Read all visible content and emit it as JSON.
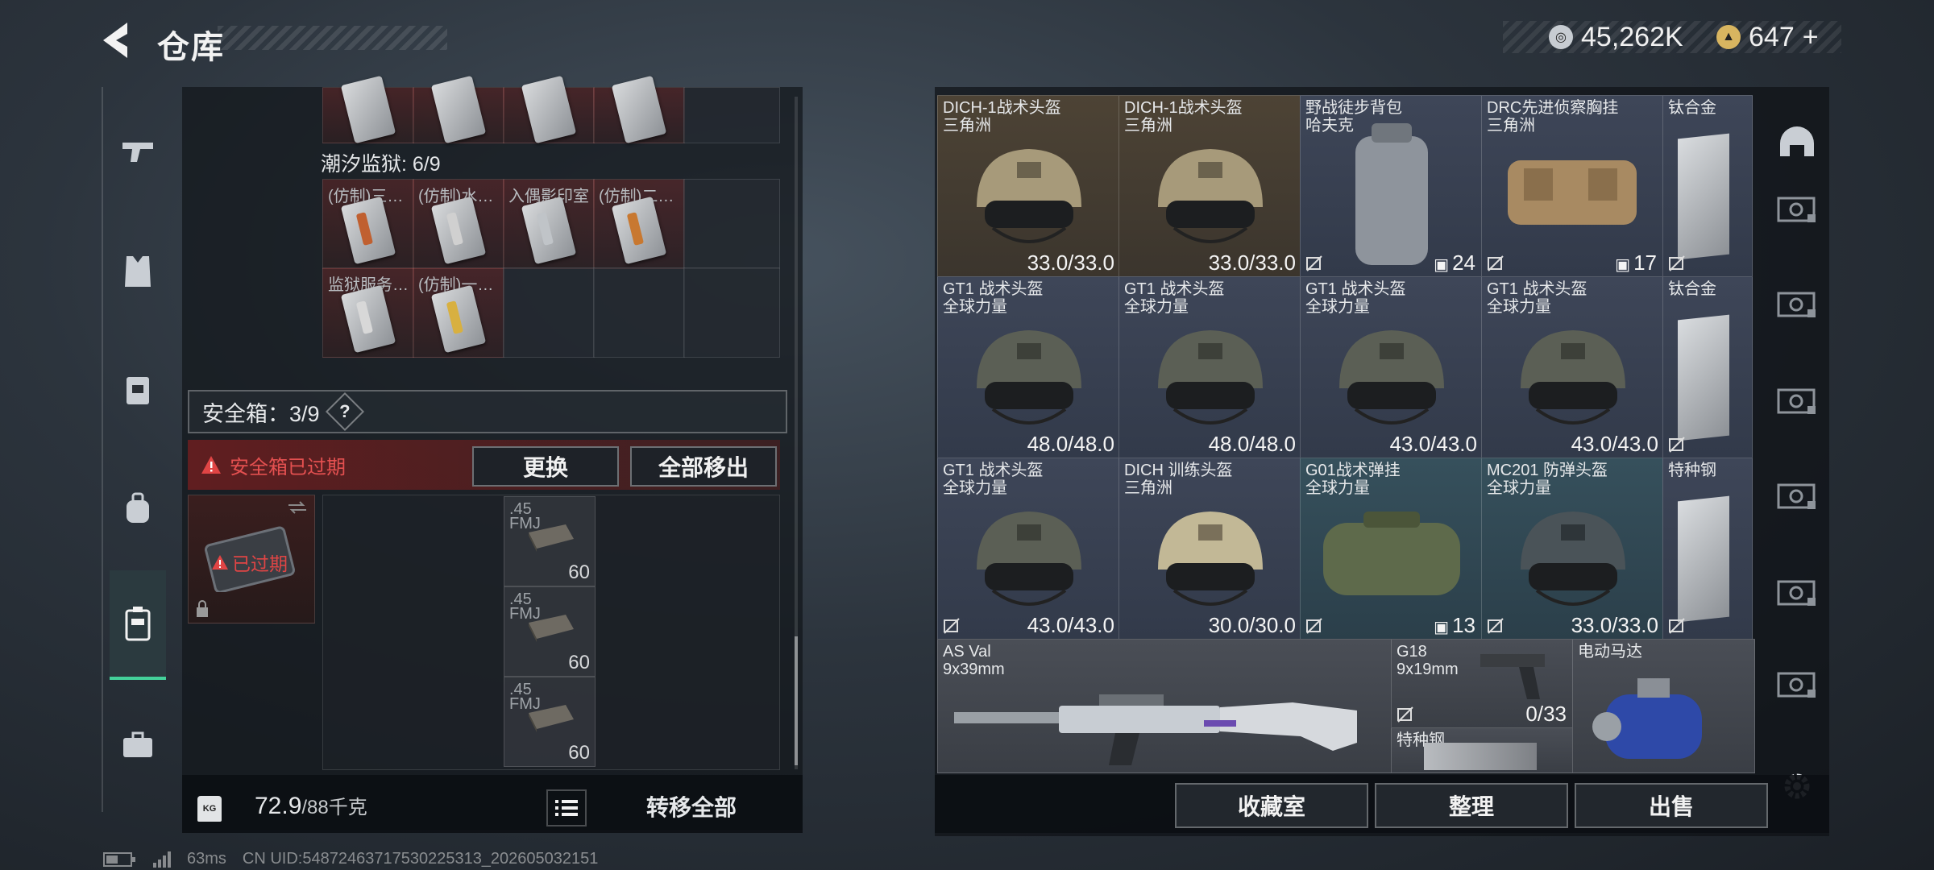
{
  "header": {
    "title": "仓库"
  },
  "currency": {
    "primary": "45,262K",
    "secondary": "647",
    "add_symbol": "+"
  },
  "sidebar": {
    "icons": [
      "gun-icon",
      "vest-icon",
      "backpack-rig-icon",
      "backpack-icon",
      "safe-case-icon",
      "briefcase-icon"
    ]
  },
  "left": {
    "top_cells": [
      "",
      "",
      "",
      ""
    ],
    "prison_label": "潮汐监狱: 6/9",
    "prison_items": [
      {
        "label": "(仿制)三…",
        "stripe": "#c06030"
      },
      {
        "label": "(仿制)水…",
        "stripe": "#d0d0d0"
      },
      {
        "label": "入偶影印室",
        "stripe": "#c0c4c8"
      },
      {
        "label": "(仿制)二…",
        "stripe": "#c87830"
      },
      {
        "label": "监狱服务…",
        "stripe": "#d8d8d8"
      },
      {
        "label": "(仿制)一…",
        "stripe": "#d8b040"
      }
    ],
    "safe_box": {
      "label": "安全箱：3/9",
      "help": "?",
      "status_text": "安全箱已过期",
      "overlay": "已过期",
      "swap_button": "更换",
      "remove_all_button": "全部移出"
    },
    "ammo": [
      {
        "caliber": ".45",
        "type": "FMJ",
        "count": "60"
      },
      {
        "caliber": ".45",
        "type": "FMJ",
        "count": "60"
      },
      {
        "caliber": ".45",
        "type": "FMJ",
        "count": "60"
      }
    ],
    "weight": {
      "current": "72.9",
      "max": "/88千克",
      "icon": "KG"
    },
    "transfer_all": "转移全部"
  },
  "grid": [
    {
      "name": "DICH-1战术头盔",
      "sub": "三角洲",
      "value": "33.0/33.0",
      "bg": "bg-brown",
      "kind": "helmet-tan"
    },
    {
      "name": "DICH-1战术头盔",
      "sub": "三角洲",
      "value": "33.0/33.0",
      "bg": "bg-brown",
      "kind": "helmet-tan"
    },
    {
      "name": "野战徒步背包",
      "sub": "哈夫克",
      "value": "24",
      "bg": "bg-blue",
      "kind": "backpack"
    },
    {
      "name": "DRC先进侦察胸挂",
      "sub": "三角洲",
      "value": "17",
      "bg": "bg-blue",
      "kind": "rig"
    },
    {
      "name": "钛合金",
      "sub": "",
      "value": "",
      "bg": "bg-blue",
      "kind": "plate"
    },
    {
      "name": "GT1 战术头盔",
      "sub": "全球力量",
      "value": "48.0/48.0",
      "bg": "bg-blue",
      "kind": "helmet-green"
    },
    {
      "name": "GT1 战术头盔",
      "sub": "全球力量",
      "value": "48.0/48.0",
      "bg": "bg-blue",
      "kind": "helmet-green"
    },
    {
      "name": "GT1 战术头盔",
      "sub": "全球力量",
      "value": "43.0/43.0",
      "bg": "bg-blue",
      "kind": "helmet-green"
    },
    {
      "name": "GT1 战术头盔",
      "sub": "全球力量",
      "value": "43.0/43.0",
      "bg": "bg-blue",
      "kind": "helmet-green"
    },
    {
      "name": "钛合金",
      "sub": "",
      "value": "",
      "bg": "bg-blue",
      "kind": "plate"
    },
    {
      "name": "GT1 战术头盔",
      "sub": "全球力量",
      "value": "43.0/43.0",
      "bg": "bg-blue",
      "kind": "helmet-green"
    },
    {
      "name": "DICH 训练头盔",
      "sub": "三角洲",
      "value": "30.0/30.0",
      "bg": "bg-blue",
      "kind": "helmet-camo"
    },
    {
      "name": "G01战术弹挂",
      "sub": "全球力量",
      "value": "13",
      "bg": "bg-teal",
      "kind": "bag"
    },
    {
      "name": "MC201 防弹头盔",
      "sub": "全球力量",
      "value": "33.0/33.0",
      "bg": "bg-teal",
      "kind": "helmet-dark"
    },
    {
      "name": "特种钢",
      "sub": "",
      "value": "",
      "bg": "bg-blue",
      "kind": "plate"
    }
  ],
  "bottom_row": {
    "asval": {
      "name": "AS Val",
      "sub": "9x39mm"
    },
    "g18": {
      "name": "G18",
      "sub": "9x19mm",
      "value": "0/33"
    },
    "motor": {
      "name": "电动马达"
    },
    "steel": {
      "name": "特种钢"
    }
  },
  "actions": {
    "collection": "收藏室",
    "sort": "整理",
    "sell": "出售"
  },
  "status": {
    "ping": "63ms",
    "uid": "CN UID:5487246371753022531​3_202605032151"
  },
  "colors": {
    "accent_green": "#44d19a",
    "warning_red": "#e04545"
  }
}
